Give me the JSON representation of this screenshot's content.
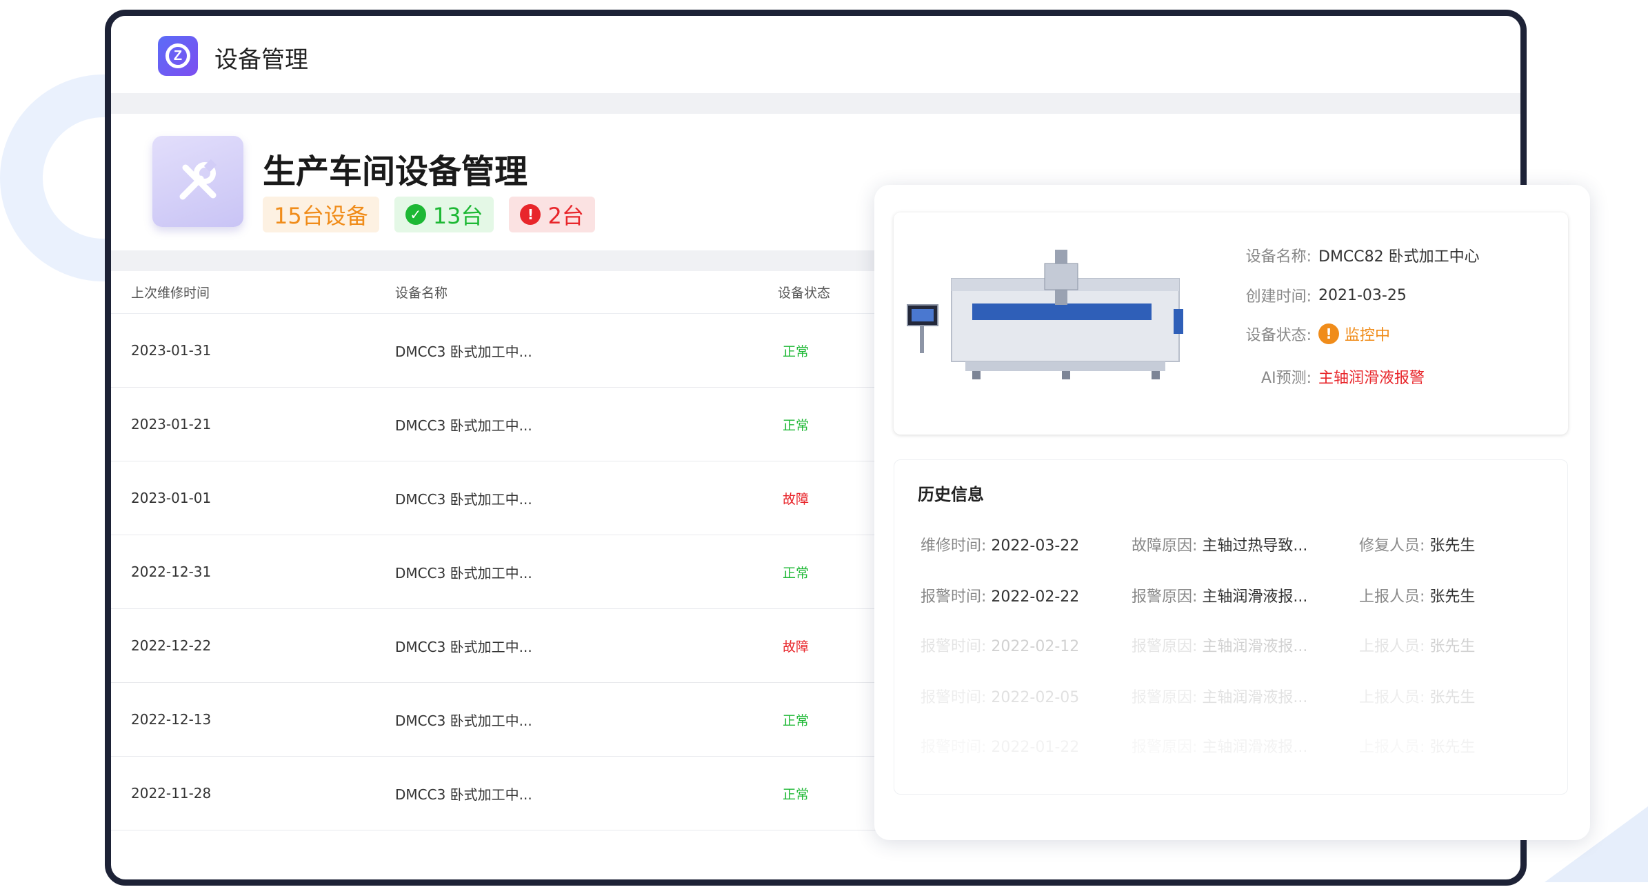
{
  "app": {
    "title": "设备管理"
  },
  "header": {
    "title": "生产车间设备管理",
    "badges": {
      "total": "15台设备",
      "ok": "13台",
      "bad": "2台"
    }
  },
  "table": {
    "headers": {
      "time": "上次维修时间",
      "name": "设备名称",
      "status": "设备状态"
    },
    "rows": [
      {
        "time": "2023-01-31",
        "name": "DMCC3  卧式加工中...",
        "status": "正常"
      },
      {
        "time": "2023-01-21",
        "name": "DMCC3  卧式加工中...",
        "status": "正常"
      },
      {
        "time": "2023-01-01",
        "name": "DMCC3  卧式加工中...",
        "status": "故障"
      },
      {
        "time": "2022-12-31",
        "name": "DMCC3  卧式加工中...",
        "status": "正常"
      },
      {
        "time": "2022-12-22",
        "name": "DMCC3  卧式加工中...",
        "status": "故障"
      },
      {
        "time": "2022-12-13",
        "name": "DMCC3  卧式加工中...",
        "status": "正常"
      },
      {
        "time": "2022-11-28",
        "name": "DMCC3  卧式加工中...",
        "status": "正常"
      }
    ]
  },
  "detail": {
    "name_label": "设备名称:",
    "name_value": "DMCC82  卧式加工中心",
    "created_label": "创建时间:",
    "created_value": "2021-03-25",
    "status_label": "设备状态:",
    "status_value": "监控中",
    "ai_label": "AI预测:",
    "ai_value": "主轴润滑液报警"
  },
  "history": {
    "title": "历史信息",
    "rows": [
      {
        "l1": "维修时间:",
        "v1": "2022-03-22",
        "l2": "故障原因:",
        "v2": "主轴过热导致...",
        "l3": "修复人员:",
        "v3": "张先生"
      },
      {
        "l1": "报警时间:",
        "v1": "2022-02-22",
        "l2": "报警原因:",
        "v2": "主轴润滑液报...",
        "l3": "上报人员:",
        "v3": "张先生"
      },
      {
        "l1": "报警时间:",
        "v1": "2022-02-12",
        "l2": "报警原因:",
        "v2": "主轴润滑液报...",
        "l3": "上报人员:",
        "v3": "张先生"
      },
      {
        "l1": "报警时间:",
        "v1": "2022-02-05",
        "l2": "报警原因:",
        "v2": "主轴润滑液报...",
        "l3": "上报人员:",
        "v3": "张先生"
      },
      {
        "l1": "报警时间:",
        "v1": "2022-01-22",
        "l2": "报警原因:",
        "v2": "主轴润滑液报...",
        "l3": "上报人员:",
        "v3": "张先生"
      }
    ]
  },
  "colors": {
    "ok": "#1db834",
    "bad": "#e8262b",
    "warn": "#f08c1a",
    "accent": "#5b6cf7"
  },
  "icons": {
    "logo": "app-logo-icon",
    "tools": "wrench-screwdriver-icon",
    "ok": "check-circle-icon",
    "bad": "exclamation-circle-icon",
    "warn": "warning-circle-icon"
  }
}
